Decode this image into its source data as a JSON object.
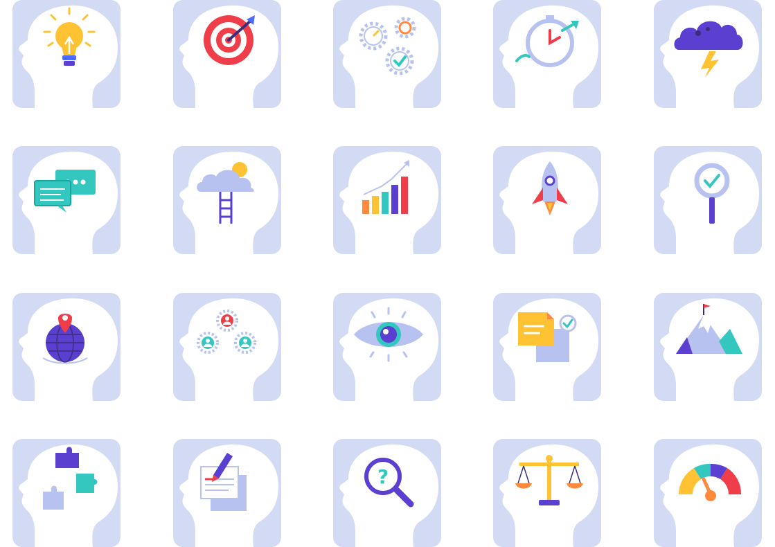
{
  "palette": {
    "tile_bg": "#d3dbf4",
    "head": "#ffffff",
    "purple": "#5b3fd1",
    "teal": "#33c7c0",
    "red": "#ef3d4a",
    "yellow": "#ffc233",
    "orange": "#ff8a3d",
    "blue": "#4b6bff",
    "light_purple": "#b8c2f0",
    "dark": "#3a2e7a"
  },
  "icons": [
    {
      "name": "lightbulb-icon"
    },
    {
      "name": "target-icon"
    },
    {
      "name": "gears-check-icon"
    },
    {
      "name": "stopwatch-icon"
    },
    {
      "name": "storm-cloud-icon"
    },
    {
      "name": "chat-bubbles-icon"
    },
    {
      "name": "cloud-ladder-icon"
    },
    {
      "name": "growth-chart-icon"
    },
    {
      "name": "rocket-icon"
    },
    {
      "name": "magnifier-check-icon"
    },
    {
      "name": "globe-pin-icon"
    },
    {
      "name": "team-gears-icon"
    },
    {
      "name": "eye-icon"
    },
    {
      "name": "document-check-icon"
    },
    {
      "name": "mountain-flag-icon"
    },
    {
      "name": "puzzle-pieces-icon"
    },
    {
      "name": "pen-writing-icon"
    },
    {
      "name": "question-magnifier-icon"
    },
    {
      "name": "justice-scale-icon"
    },
    {
      "name": "speedometer-icon"
    }
  ]
}
